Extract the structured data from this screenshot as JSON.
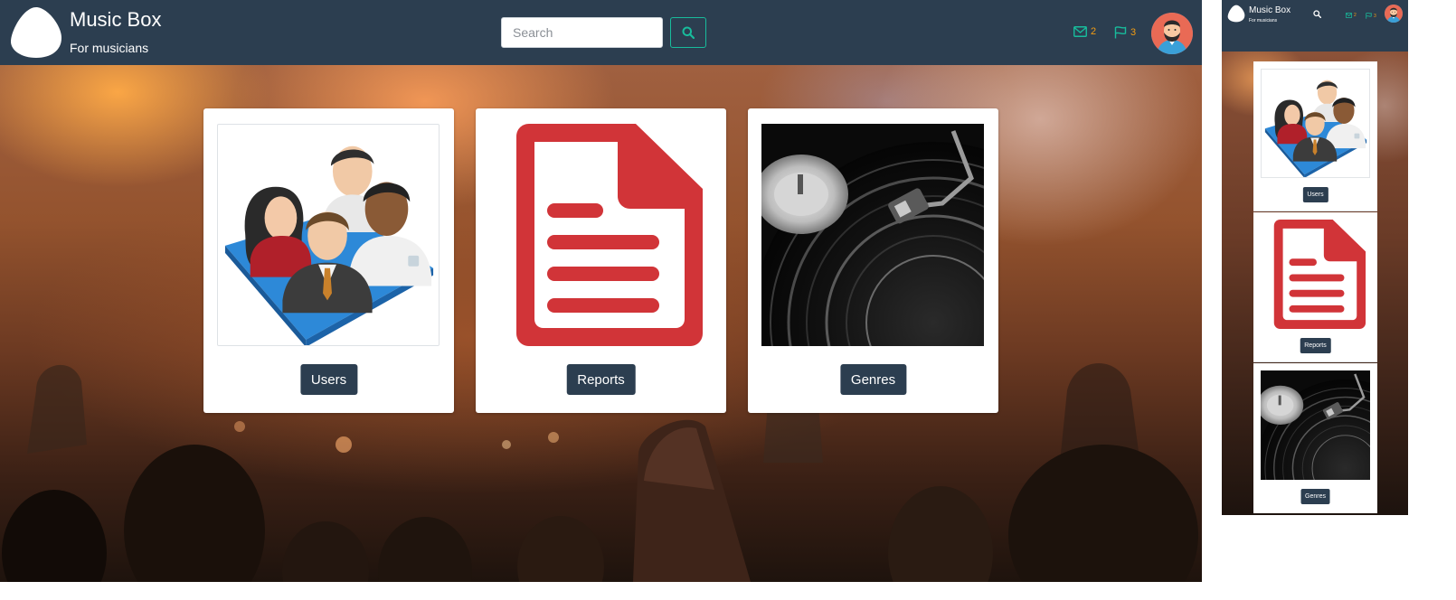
{
  "app": {
    "title": "Music Box",
    "subtitle": "For musicians"
  },
  "search": {
    "placeholder": "Search",
    "value": ""
  },
  "notifications": {
    "messages_count": "2",
    "flags_count": "3"
  },
  "cards": [
    {
      "label": "Users",
      "icon": "users-group-icon"
    },
    {
      "label": "Reports",
      "icon": "document-icon"
    },
    {
      "label": "Genres",
      "icon": "vinyl-turntable-image"
    }
  ],
  "mobile": {
    "title": "Music Box",
    "subtitle": "For musicians",
    "messages_count": "2",
    "flags_count": "3"
  },
  "colors": {
    "navbar": "#2c3e50",
    "accent": "#18bc9c",
    "badge": "#f39c12",
    "report_red": "#d13438"
  }
}
